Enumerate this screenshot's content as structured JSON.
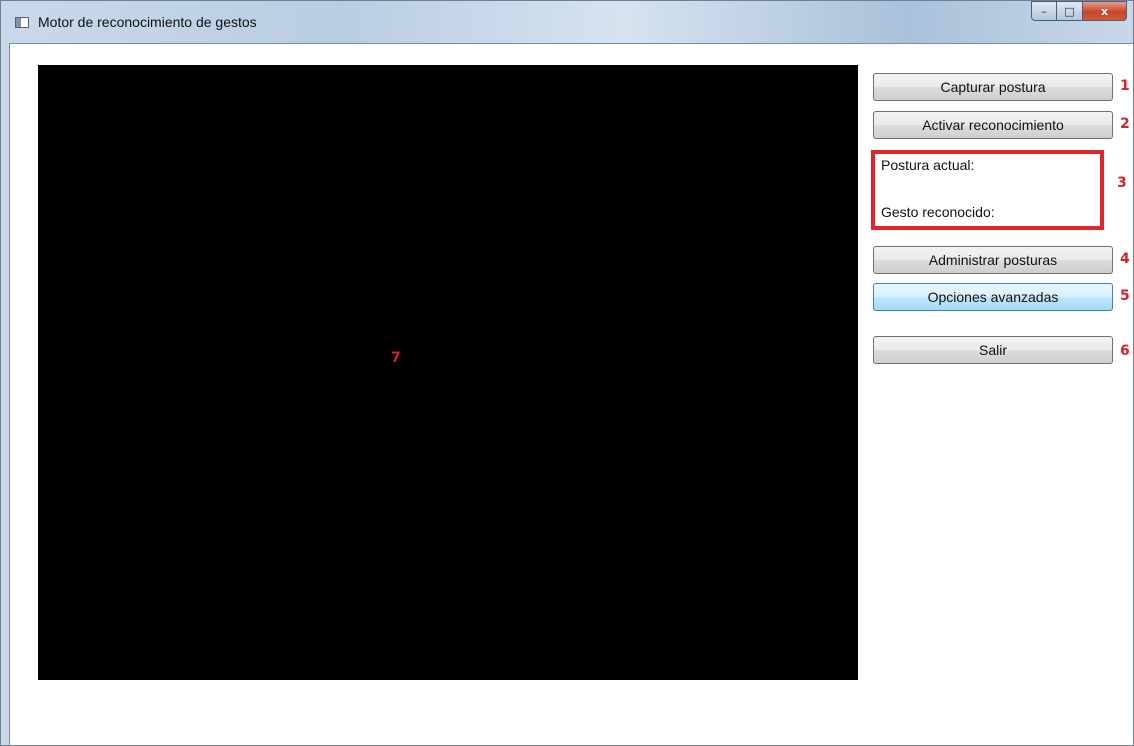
{
  "window": {
    "title": "Motor de reconocimiento de gestos",
    "controls": {
      "minimize": "–",
      "maximize": "□",
      "close": "x"
    }
  },
  "video_panel": {
    "marker": "7"
  },
  "sidebar": {
    "buttons": [
      {
        "label": "Capturar postura",
        "marker": "1"
      },
      {
        "label": "Activar reconocimiento",
        "marker": "2"
      },
      {
        "label": "Administrar posturas",
        "marker": "4"
      },
      {
        "label": "Opciones avanzadas",
        "marker": "5"
      },
      {
        "label": "Salir",
        "marker": "6"
      }
    ],
    "info_box": {
      "current_posture_label": "Postura actual:",
      "recognized_gesture_label": "Gesto reconocido:",
      "marker": "3"
    }
  },
  "colors": {
    "annotation": "#e0262c",
    "focused_button": "#bee6fd",
    "video_background": "#000000"
  }
}
